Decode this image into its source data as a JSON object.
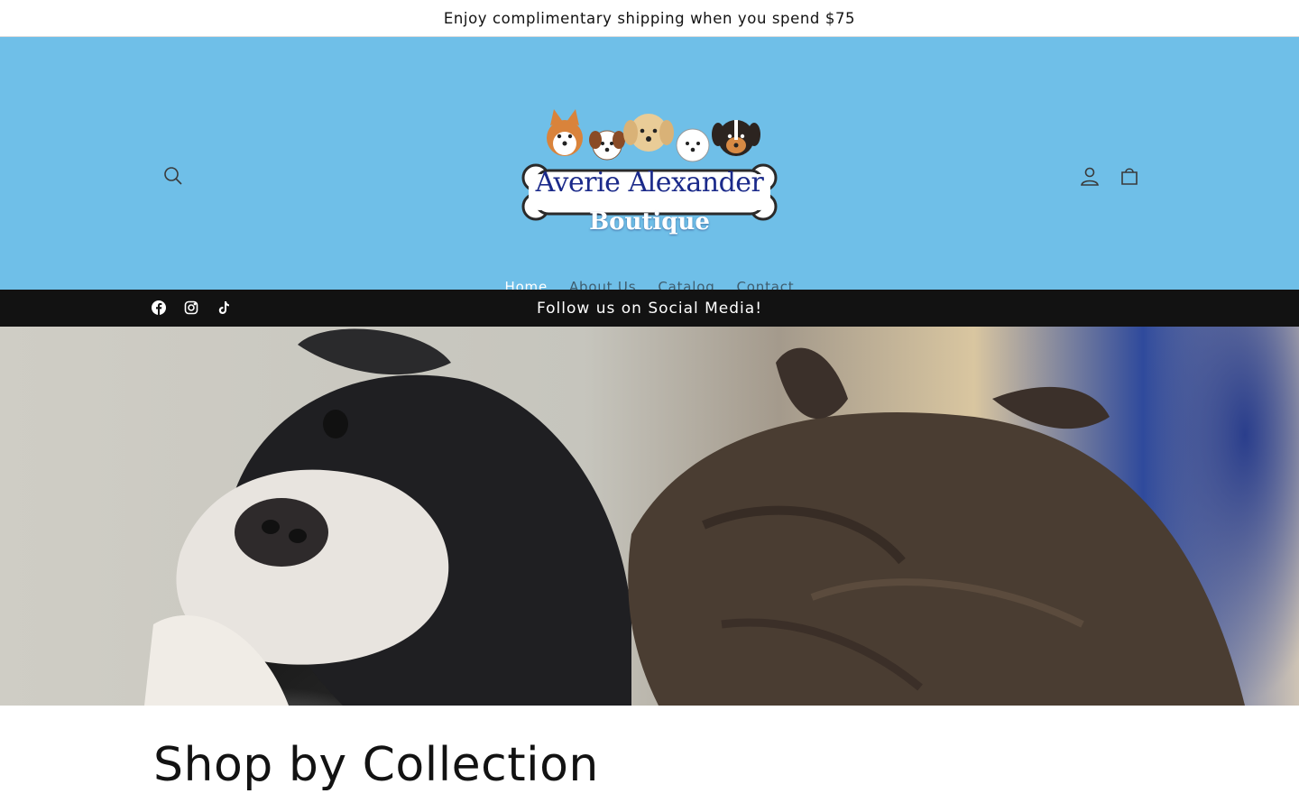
{
  "announcement": {
    "text": "Enjoy complimentary shipping when you spend $75"
  },
  "header": {
    "background": "#6fbfe8",
    "logo": {
      "title": "Averie Alexander",
      "subtitle": "Boutique"
    },
    "icons": [
      "search-icon",
      "account-icon",
      "cart-icon"
    ]
  },
  "nav": {
    "items": [
      {
        "label": "Home",
        "active": true
      },
      {
        "label": "About Us",
        "active": false
      },
      {
        "label": "Catalog",
        "active": false
      },
      {
        "label": "Contact",
        "active": false
      }
    ]
  },
  "social_bar": {
    "text": "Follow us on Social Media!",
    "icons": [
      "facebook-icon",
      "instagram-icon",
      "tiktok-icon"
    ]
  },
  "collections": {
    "title": "Shop by Collection"
  }
}
